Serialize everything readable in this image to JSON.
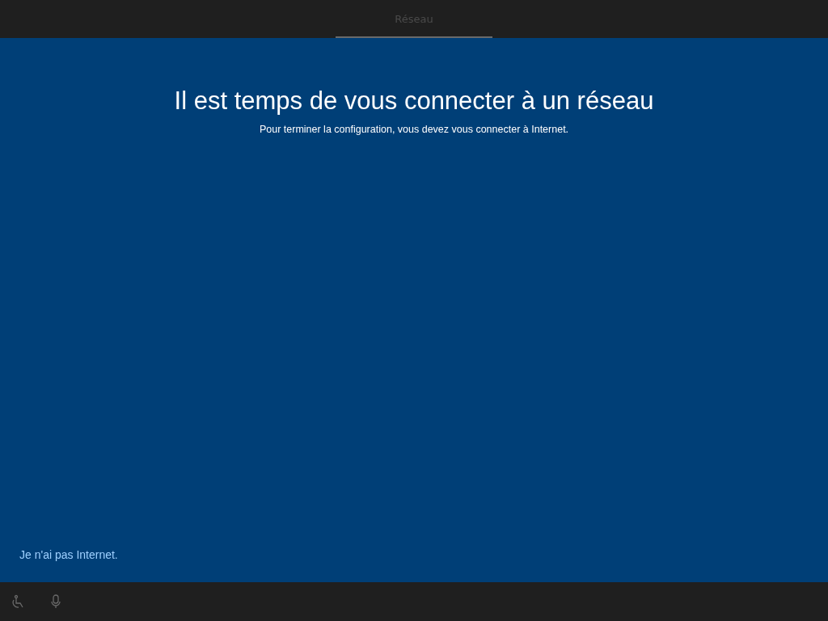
{
  "tabs": [
    {
      "label": "Réseau",
      "selected": true
    }
  ],
  "heading": "Il est temps de vous connecter à un réseau",
  "subtitle": "Pour terminer la configuration, vous devez vous connecter à Internet.",
  "skip_link": "Je n'ai pas Internet.",
  "footer_icons": [
    {
      "kind": "accessibility"
    },
    {
      "kind": "microphone"
    }
  ]
}
